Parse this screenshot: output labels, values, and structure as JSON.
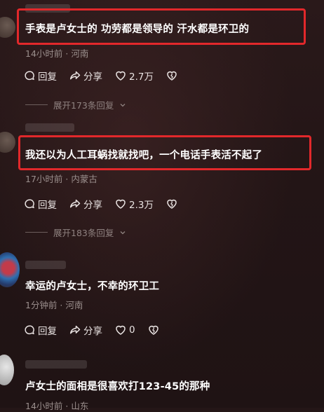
{
  "comments": [
    {
      "text": "手表是卢女士的 功劳都是领导的 汗水都是环卫的",
      "meta": "14小时前 · 河南",
      "reply_label": "回复",
      "share_label": "分享",
      "likes": "2.7万",
      "expand_label": "展开173条回复"
    },
    {
      "text": "我还以为人工耳蜗找就找吧，一个电话手表活不起了",
      "meta": "17小时前 · 内蒙古",
      "reply_label": "回复",
      "share_label": "分享",
      "likes": "2.3万",
      "expand_label": "展开183条回复"
    },
    {
      "text": "幸运的卢女士，不幸的环卫工",
      "meta": "1分钟前 · 河南",
      "reply_label": "回复",
      "share_label": "分享",
      "likes": "0"
    },
    {
      "text": "卢女士的面相是很喜欢打123-45的那种",
      "meta": "14小时前 · 山东"
    }
  ],
  "colors": {
    "highlight": "#e2282b",
    "background": "#241617"
  },
  "icons": [
    "comment-icon",
    "share-icon",
    "heart-icon",
    "broken-heart-icon",
    "chevron-down-icon"
  ]
}
